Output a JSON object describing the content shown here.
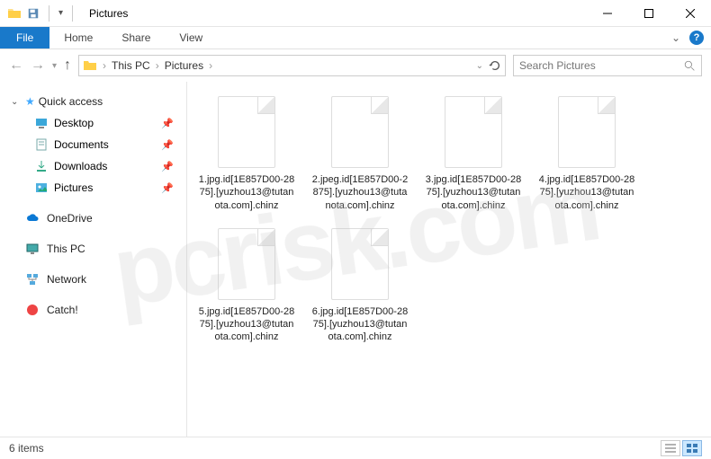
{
  "titlebar": {
    "title": "Pictures"
  },
  "ribbon": {
    "file": "File",
    "tabs": [
      "Home",
      "Share",
      "View"
    ]
  },
  "address": {
    "crumbs": [
      "This PC",
      "Pictures"
    ],
    "search_placeholder": "Search Pictures"
  },
  "sidebar": {
    "quick_access": "Quick access",
    "items": [
      {
        "label": "Desktop"
      },
      {
        "label": "Documents"
      },
      {
        "label": "Downloads"
      },
      {
        "label": "Pictures",
        "selected": true
      }
    ],
    "onedrive": "OneDrive",
    "thispc": "This PC",
    "network": "Network",
    "catch": "Catch!"
  },
  "files": [
    "1.jpg.id[1E857D00-2875].[yuzhou13@tutanota.com].chinz",
    "2.jpeg.id[1E857D00-2875].[yuzhou13@tutanota.com].chinz",
    "3.jpg.id[1E857D00-2875].[yuzhou13@tutanota.com].chinz",
    "4.jpg.id[1E857D00-2875].[yuzhou13@tutanota.com].chinz",
    "5.jpg.id[1E857D00-2875].[yuzhou13@tutanota.com].chinz",
    "6.jpg.id[1E857D00-2875].[yuzhou13@tutanota.com].chinz"
  ],
  "status": {
    "count": "6 items"
  },
  "watermark": "pcrisk.com"
}
